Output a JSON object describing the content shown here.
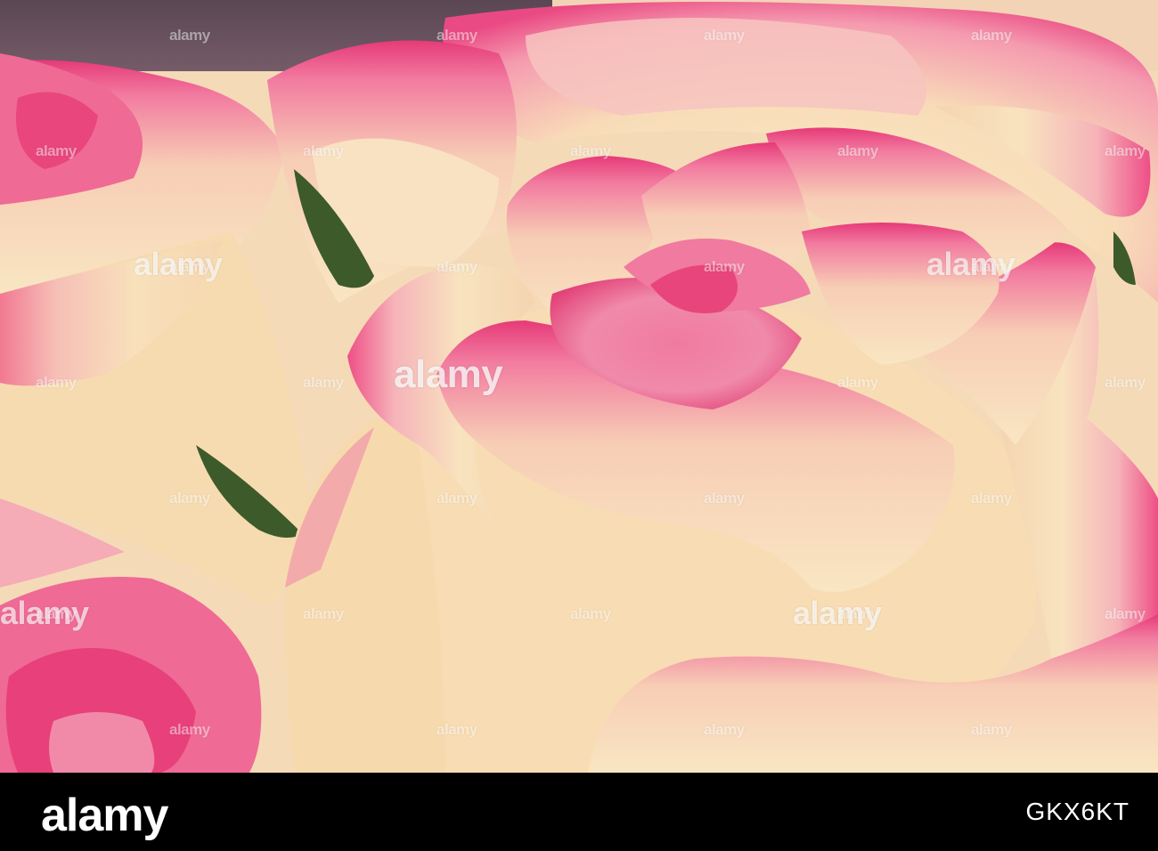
{
  "photo": {
    "subject": "pink-tipped cream roses",
    "palette": {
      "cream": "#f7e4c0",
      "pink": "#ee4f86",
      "deep_pink": "#e0306e",
      "leaf": "#3d5a2a",
      "shadow": "#4a3d49"
    }
  },
  "watermark": {
    "brand": "alamy"
  },
  "footer": {
    "logo": "alamy",
    "image_id": "GKX6KT"
  }
}
